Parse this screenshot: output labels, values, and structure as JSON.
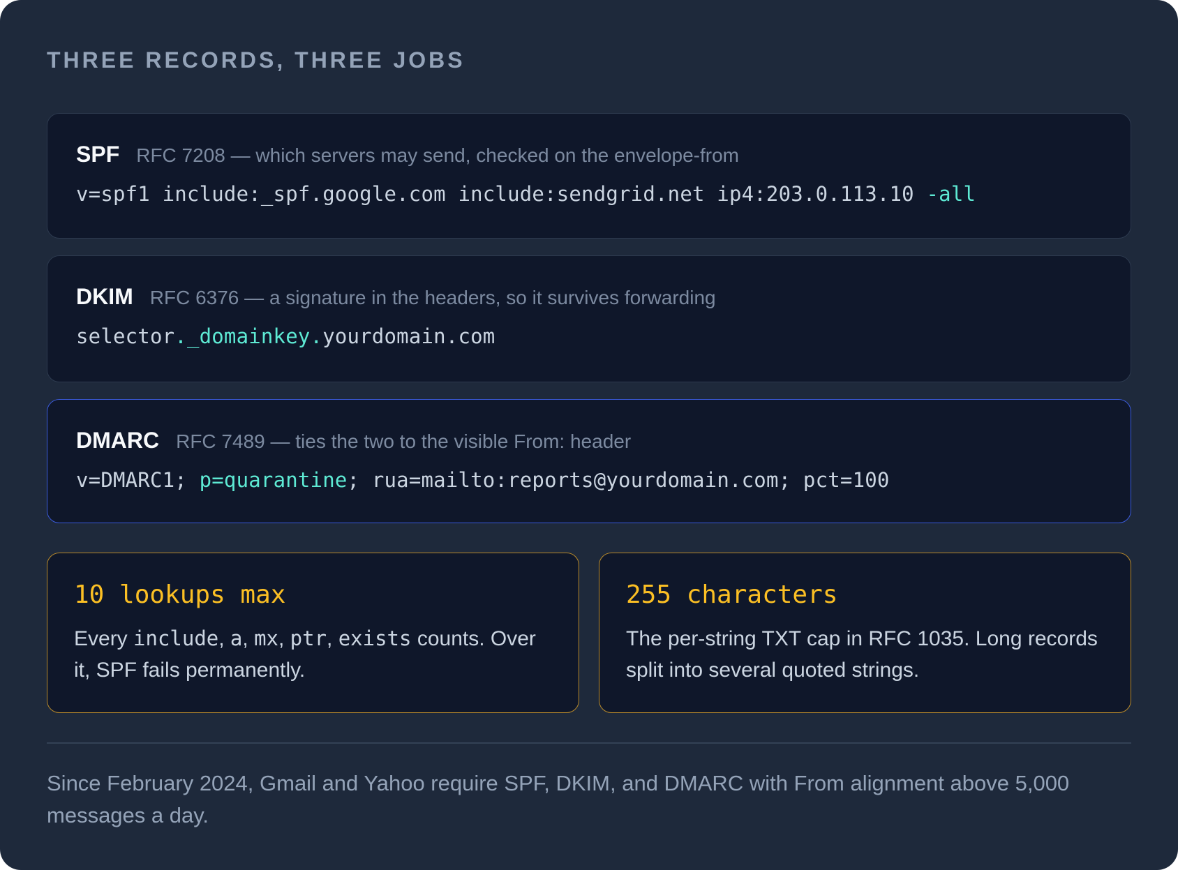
{
  "heading": "THREE RECORDS, THREE JOBS",
  "records": [
    {
      "name": "SPF",
      "description": "RFC 7208 — which servers may send, checked on the envelope-from",
      "code_before": "v=spf1 include:_spf.google.com include:sendgrid.net ip4:203.0.113.10 ",
      "code_highlight": "-all",
      "code_after": ""
    },
    {
      "name": "DKIM",
      "description": "RFC 6376 — a signature in the headers, so it survives forwarding",
      "code_before": "selector",
      "code_highlight": "._domainkey.",
      "code_after": "yourdomain.com"
    },
    {
      "name": "DMARC",
      "description": "RFC 7489 — ties the two to the visible From: header",
      "code_before": "v=DMARC1; ",
      "code_highlight": "p=quarantine",
      "code_after": "; rua=mailto:reports@yourdomain.com; pct=100"
    }
  ],
  "limits": [
    {
      "title": "10 lookups max",
      "body_parts": [
        "Every ",
        "include",
        ", ",
        "a",
        ", ",
        "mx",
        ", ",
        "ptr",
        ", ",
        "exists",
        " counts. Over it, SPF fails permanently."
      ]
    },
    {
      "title": "255 characters",
      "body": "The per-string TXT cap in RFC 1035. Long records split into several quoted strings."
    }
  ],
  "footnote": "Since February 2024, Gmail and Yahoo require SPF, DKIM, and DMARC with From alignment above 5,000 messages a day.",
  "colors": {
    "panel_bg": "#1e293b",
    "card_bg": "#0f172a",
    "highlight": "#5eead4",
    "limit_accent": "#fbbf24",
    "dmarc_border": "#3b5bdb"
  }
}
